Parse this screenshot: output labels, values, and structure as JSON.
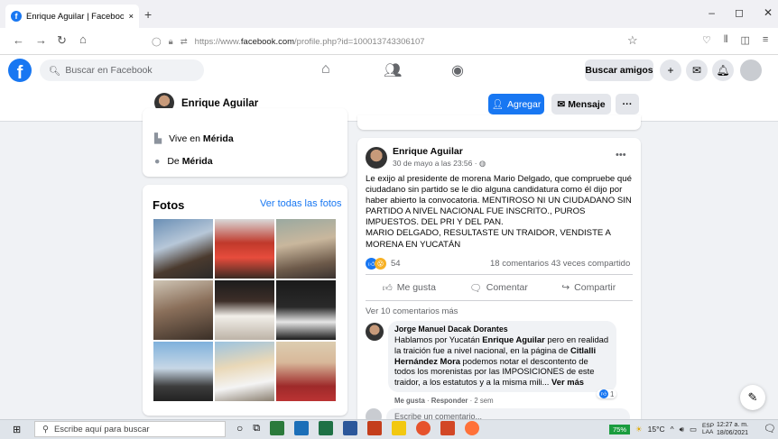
{
  "browser": {
    "tab_title": "Enrique Aguilar | Facebook",
    "tab_close": "×",
    "new_tab": "+",
    "url_prefix": "https://www.",
    "url_domain": "facebook.com",
    "url_path": "/profile.php?id=100013743306107"
  },
  "facebook": {
    "logo": "f",
    "search_placeholder": "Buscar en Facebook",
    "buscar_amigos": "Buscar amigos",
    "plus": "+"
  },
  "profile": {
    "name": "Enrique Aguilar",
    "add_label": "Agregar",
    "message_label": "Mensaje",
    "more_label": "···"
  },
  "intro": {
    "lives_prefix": "Vive en ",
    "lives_city": "Mérida",
    "from_prefix": "De ",
    "from_city": "Mérida"
  },
  "photos": {
    "title": "Fotos",
    "see_all": "Ver todas las fotos"
  },
  "post": {
    "author": "Enrique Aguilar",
    "date": "30 de mayo a las 23:56 · ",
    "text_1": "Le exijo al presidente de morena Mario Delgado, que compruebe qué ciudadano sin partido se le dio alguna candidatura como él dijo por haber abierto la convocatoria. MENTIROSO NI UN CIUDADANO SIN PARTIDO A NIVEL NACIONAL FUE INSCRITO., PUROS IMPUESTOS. DEL PRI Y DEL PAN.",
    "text_2": "MARIO DELGADO, RESULTASTE UN TRAIDOR, VENDISTE A MORENA EN YUCATÁN",
    "reaction_count": "54",
    "comments_count": "18 comentarios",
    "shares_count": "43 veces compartido",
    "like_label": "Me gusta",
    "comment_label": "Comentar",
    "share_label": "Compartir",
    "more_comments": "Ver 10 comentarios más",
    "write_placeholder": "Escribe un comentario..."
  },
  "comment": {
    "author": "Jorge Manuel Dacak Dorantes",
    "t1": "Hablamos por Yucatán ",
    "b1": "Enrique Aguilar",
    "t2": " pero en realidad la traición fue a nivel nacional, en la página de ",
    "b2": "Citlalli Hernández Mora",
    "t3": " podemos notar el descontento de todos los morenistas por las IMPOSICIONES de este traidor, a los estatutos y a la misma mili... ",
    "see_more": "Ver más",
    "like": "Me gusta",
    "reply": "Responder",
    "age": "2 sem",
    "like_count": "1"
  },
  "taskbar": {
    "search_text": "Escribe aquí para buscar",
    "battery": "75%",
    "temp": "15°C",
    "lang1": "ESP",
    "lang2": "LAA",
    "time": "12:27 a. m.",
    "date": "18/06/2021"
  },
  "icons": [
    "facebook-logo-icon",
    "search-icon",
    "home-icon",
    "friends-icon",
    "groups-icon",
    "messenger-icon",
    "bell-icon",
    "edit-icon",
    "windows-icon"
  ]
}
